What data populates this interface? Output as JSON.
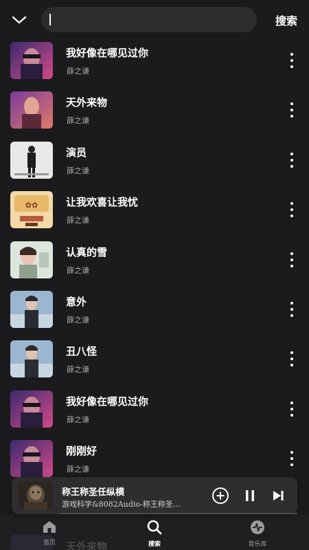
{
  "search": {
    "value": "",
    "button_label": "搜索"
  },
  "songs": [
    {
      "title": "我好像在哪见过你",
      "artist": "薛之谦",
      "cover": "purple-portrait"
    },
    {
      "title": "天外来物",
      "artist": "薛之谦",
      "cover": "red-portrait"
    },
    {
      "title": "演员",
      "artist": "薛之谦",
      "cover": "bw-standing"
    },
    {
      "title": "让我欢喜让我忧",
      "artist": "薛之谦",
      "cover": "album-art"
    },
    {
      "title": "认真的雪",
      "artist": "薛之谦",
      "cover": "white-portrait"
    },
    {
      "title": "意外",
      "artist": "薛之谦",
      "cover": "blue-portrait"
    },
    {
      "title": "丑八怪",
      "artist": "薛之谦",
      "cover": "blue-portrait"
    },
    {
      "title": "我好像在哪见过你",
      "artist": "薛之谦",
      "cover": "purple-portrait"
    },
    {
      "title": "刚刚好",
      "artist": "薛之谦",
      "cover": "purple-portrait"
    }
  ],
  "player": {
    "title": "称王称圣任纵横",
    "subtitle": "游戏科学&8082Audio-称王称圣…"
  },
  "bottom_nav": {
    "items": [
      {
        "label": "首页",
        "icon": "home-icon",
        "active": false
      },
      {
        "label": "搜索",
        "icon": "search-icon",
        "active": true
      },
      {
        "label": "音乐库",
        "icon": "waveform-icon",
        "active": false
      }
    ],
    "ghost_title": "天外来物"
  },
  "colors": {
    "background": "#1b1b1d",
    "surface": "#2c2c2f",
    "text_primary": "#ffffff",
    "text_secondary": "#a7a7aa"
  }
}
